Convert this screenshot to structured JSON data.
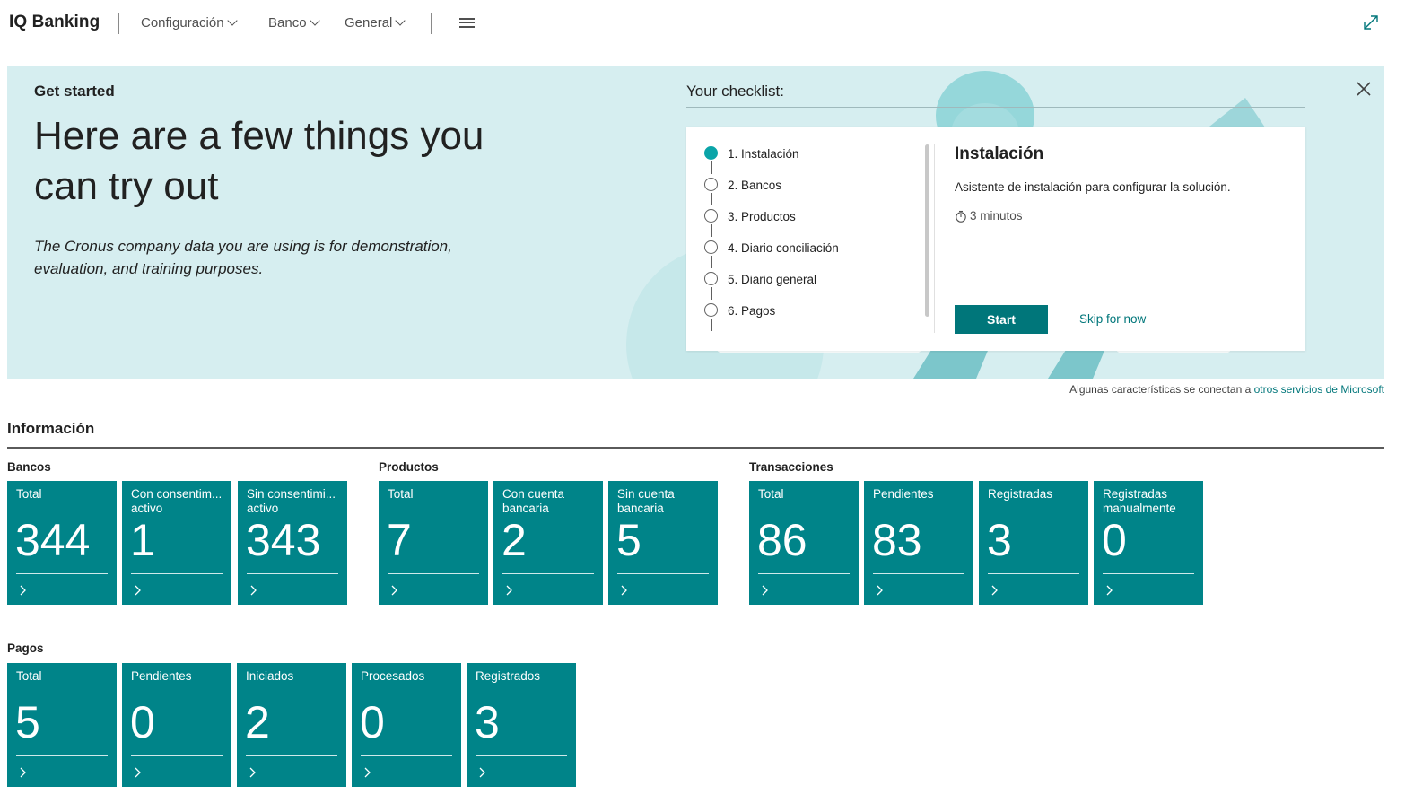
{
  "app": {
    "title": "IQ Banking",
    "nav": [
      {
        "label": "Configuración"
      },
      {
        "label": "Banco"
      },
      {
        "label": "General"
      }
    ]
  },
  "banner": {
    "heading_small": "Get started",
    "heading_large": "Here are a few things you can try out",
    "description": "The Cronus company data you are using is for demonstration, evaluation, and training purposes.",
    "checklist_label": "Your checklist:",
    "steps": [
      {
        "label": "1. Instalación",
        "active": true
      },
      {
        "label": "2. Bancos",
        "active": false
      },
      {
        "label": "3. Productos",
        "active": false
      },
      {
        "label": "4. Diario conciliación",
        "active": false
      },
      {
        "label": "5. Diario general",
        "active": false
      },
      {
        "label": "6. Pagos",
        "active": false
      }
    ],
    "detail": {
      "title": "Instalación",
      "description": "Asistente de instalación para configurar la solución.",
      "time": "3 minutos",
      "start_label": "Start",
      "skip_label": "Skip for now"
    }
  },
  "ms_note": {
    "text": "Algunas características se conectan a",
    "link": "otros servicios de Microsoft"
  },
  "info": {
    "title": "Información",
    "groups": {
      "bancos": {
        "title": "Bancos",
        "tiles": [
          {
            "label": "Total",
            "value": "344"
          },
          {
            "label": "Con consentim... activo",
            "value": "1"
          },
          {
            "label": "Sin consentimi... activo",
            "value": "343"
          }
        ]
      },
      "productos": {
        "title": "Productos",
        "tiles": [
          {
            "label": "Total",
            "value": "7"
          },
          {
            "label": "Con cuenta bancaria",
            "value": "2"
          },
          {
            "label": "Sin cuenta bancaria",
            "value": "5"
          }
        ]
      },
      "transacciones": {
        "title": "Transacciones",
        "tiles": [
          {
            "label": "Total",
            "value": "86"
          },
          {
            "label": "Pendientes",
            "value": "83"
          },
          {
            "label": "Registradas",
            "value": "3"
          },
          {
            "label": "Registradas manualmente",
            "value": "0"
          }
        ]
      },
      "pagos": {
        "title": "Pagos",
        "tiles": [
          {
            "label": "Total",
            "value": "5"
          },
          {
            "label": "Pendientes",
            "value": "0"
          },
          {
            "label": "Iniciados",
            "value": "2"
          },
          {
            "label": "Procesados",
            "value": "0"
          },
          {
            "label": "Registrados",
            "value": "3"
          }
        ]
      }
    }
  },
  "colors": {
    "tile": "#008489",
    "accent": "#00767a",
    "banner_bg": "#d6eef0",
    "step_active": "#0aa4a8"
  },
  "icons": [
    "chevron-down-icon",
    "hamburger-menu-icon",
    "expand-icon",
    "close-icon",
    "timer-icon",
    "chevron-right-icon"
  ]
}
